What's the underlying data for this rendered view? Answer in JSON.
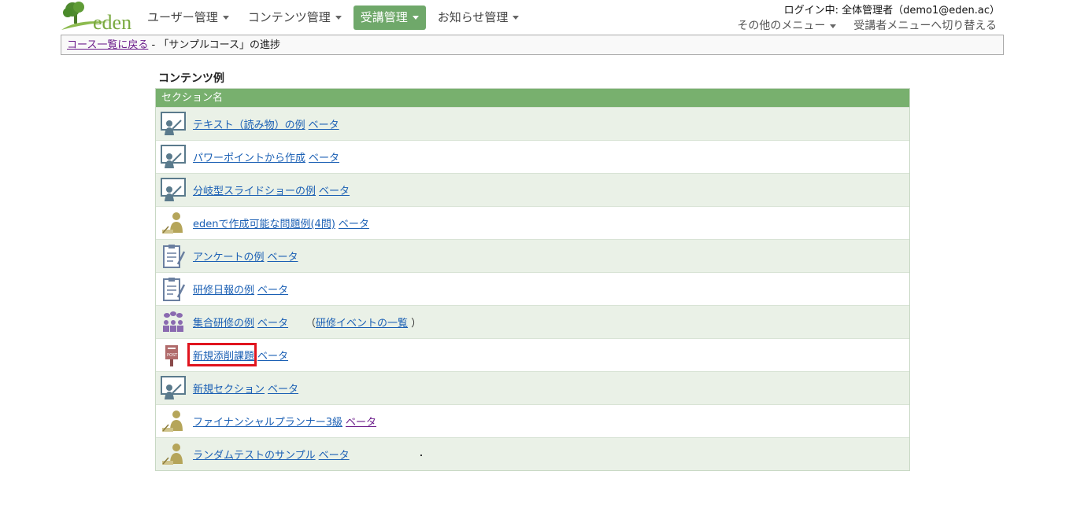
{
  "brand": {
    "logo_text": "eden"
  },
  "nav": [
    {
      "label": "ユーザー管理",
      "active": false
    },
    {
      "label": "コンテンツ管理",
      "active": false
    },
    {
      "label": "受講管理",
      "active": true
    },
    {
      "label": "お知らせ管理",
      "active": false
    }
  ],
  "login": {
    "text": "ログイン中: 全体管理者（demo1@eden.ac）"
  },
  "topright": {
    "other_menu": "その他のメニュー",
    "switch_menu": "受講者メニューへ切り替える"
  },
  "breadcrumb": {
    "back_link": "コース一覧に戻る",
    "separator": " - ",
    "current": "「サンプルコース」の進捗"
  },
  "content": {
    "title": "コンテンツ例",
    "header": "セクション名",
    "rows": [
      {
        "icon": "presentation-icon",
        "name": "テキスト（読み物）の例",
        "beta": "ベータ"
      },
      {
        "icon": "presentation-icon",
        "name": "パワーポイントから作成",
        "beta": "ベータ"
      },
      {
        "icon": "presentation-icon",
        "name": "分岐型スライドショーの例",
        "beta": "ベータ"
      },
      {
        "icon": "test-taker-icon",
        "name": "edenで作成可能な問題例(4問)",
        "beta": "ベータ"
      },
      {
        "icon": "clipboard-icon",
        "name": "アンケートの例",
        "beta": "ベータ"
      },
      {
        "icon": "clipboard-icon",
        "name": "研修日報の例",
        "beta": "ベータ"
      },
      {
        "icon": "group-training-icon",
        "name": "集合研修の例",
        "beta": "ベータ",
        "extra_open": "（",
        "extra_link": "研修イベントの一覧",
        "extra_close": "）"
      },
      {
        "icon": "post-box-icon",
        "name": "新規添削課題",
        "beta": "ベータ",
        "highlighted": true
      },
      {
        "icon": "presentation-icon",
        "name": "新規セクション",
        "beta": "ベータ"
      },
      {
        "icon": "test-taker-icon",
        "name": "ファイナンシャルプランナー3級",
        "beta": "ベータ"
      },
      {
        "icon": "test-taker-icon",
        "name": "ランダムテストのサンプル",
        "beta": "ベータ"
      }
    ]
  }
}
